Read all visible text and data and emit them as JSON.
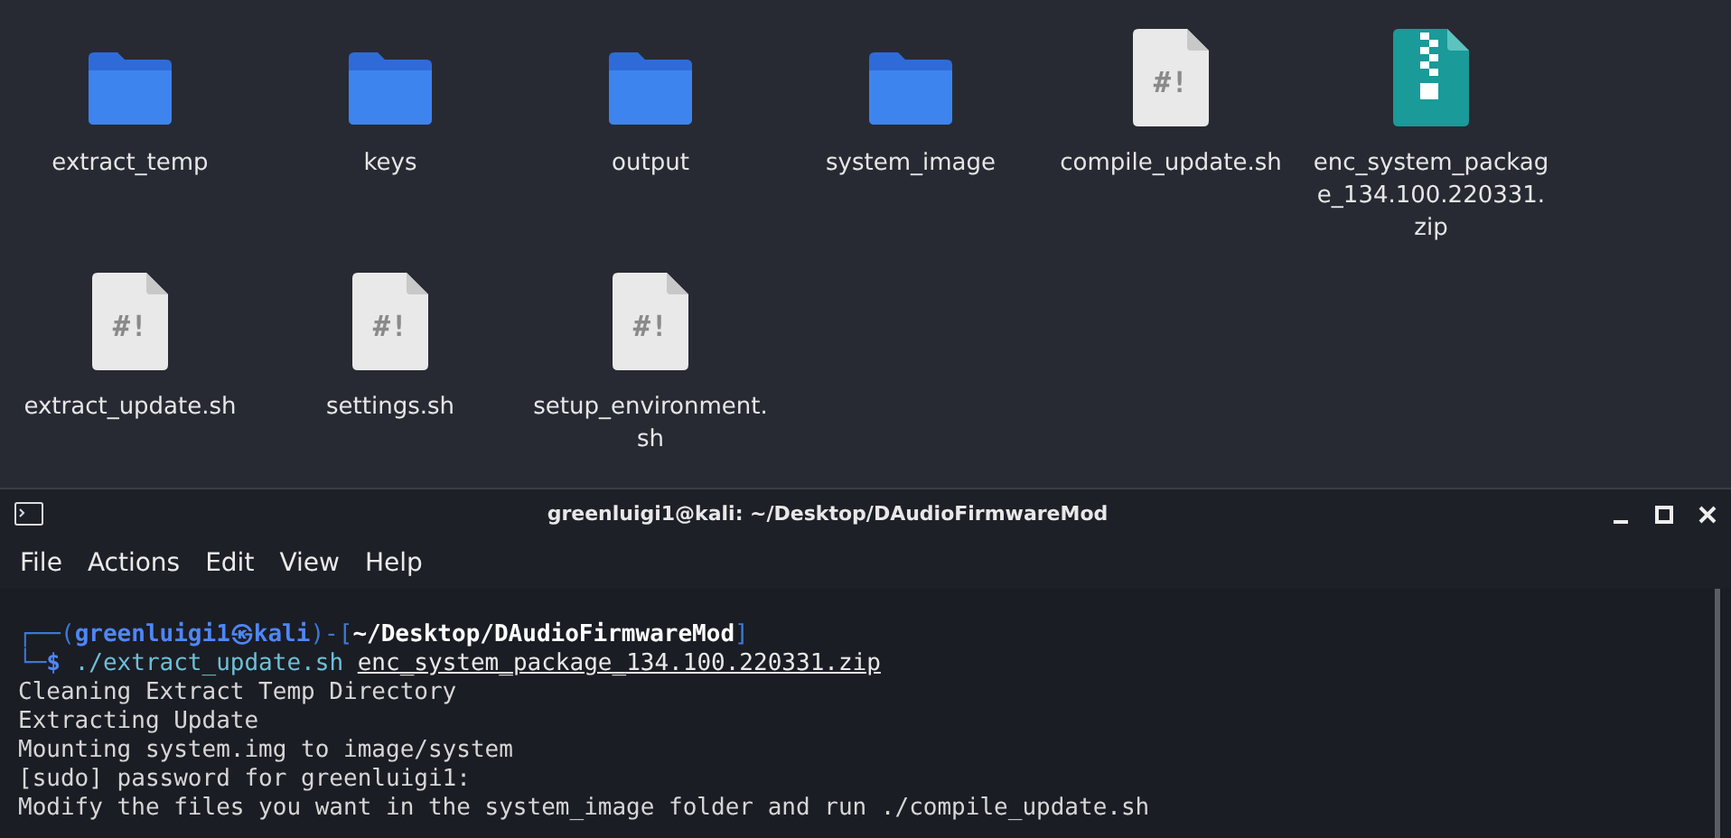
{
  "desktop": {
    "items": [
      {
        "label": "extract_temp",
        "kind": "folder"
      },
      {
        "label": "keys",
        "kind": "folder"
      },
      {
        "label": "output",
        "kind": "folder"
      },
      {
        "label": "system_image",
        "kind": "folder"
      },
      {
        "label": "compile_update.sh",
        "kind": "script",
        "icon_text": "#!"
      },
      {
        "label": "enc_system_package_134.100.220331.zip",
        "kind": "archive"
      },
      {
        "label": "extract_update.sh",
        "kind": "script",
        "icon_text": "#!"
      },
      {
        "label": "settings.sh",
        "kind": "script",
        "icon_text": "#!"
      },
      {
        "label": "setup_environment.sh",
        "kind": "script",
        "icon_text": "#!"
      }
    ]
  },
  "terminal": {
    "title": "greenluigi1@kali: ~/Desktop/DAudioFirmwareMod",
    "menu": [
      "File",
      "Actions",
      "Edit",
      "View",
      "Help"
    ],
    "prompt": [
      {
        "text": "┌──(",
        "kind": "frame"
      },
      {
        "text": "greenluigi1",
        "kind": "user"
      },
      {
        "text": "㉿",
        "kind": "user"
      },
      {
        "text": "kali",
        "kind": "user"
      },
      {
        "text": ")-[",
        "kind": "frame"
      },
      {
        "text": "~/Desktop/DAudioFirmwareMod",
        "kind": "path"
      },
      {
        "text": "]",
        "kind": "frame"
      }
    ],
    "command": [
      {
        "text": "└─",
        "kind": "frame"
      },
      {
        "text": "$ ",
        "kind": "dollar"
      },
      {
        "text": "./extract_update.sh ",
        "kind": "command"
      },
      {
        "text": "enc_system_package_134.100.220331.zip",
        "kind": "argument"
      }
    ],
    "output": [
      "Cleaning Extract Temp Directory",
      "Extracting Update",
      "Mounting system.img to image/system",
      "[sudo] password for greenluigi1:",
      "Modify the files you want in the system_image folder and run ./compile_update.sh"
    ]
  }
}
